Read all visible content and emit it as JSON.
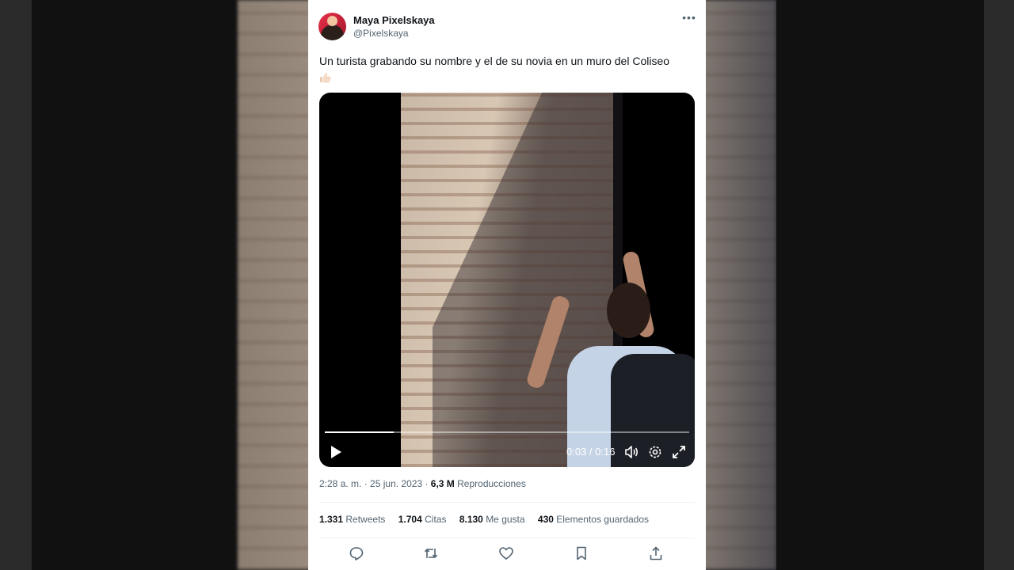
{
  "tweet": {
    "display_name": "Maya Pixelskaya",
    "handle": "@Pixelskaya",
    "text": "Un turista grabando su nombre y el de su novia en un muro del Coliseo",
    "emoji": "thumbs-up-icon"
  },
  "video": {
    "time_display": "0:03 / 0:16",
    "progress_fraction": 0.19,
    "controls": [
      "play-icon",
      "volume-icon",
      "gear-icon",
      "fullscreen-icon"
    ]
  },
  "meta": {
    "time": "2:28 a. m.",
    "separator": " · ",
    "date": "25 jun. 2023",
    "views_count": "6,3 M",
    "views_label": "Reproducciones"
  },
  "stats": {
    "retweets_count": "1.331",
    "retweets_label": "Retweets",
    "quotes_count": "1.704",
    "quotes_label": "Citas",
    "likes_count": "8.130",
    "likes_label": "Me gusta",
    "bookmarks_count": "430",
    "bookmarks_label": "Elementos guardados"
  },
  "actions": [
    "reply-icon",
    "retweet-icon",
    "like-icon",
    "bookmark-icon",
    "share-icon"
  ],
  "colors": {
    "text_primary": "#0f1419",
    "text_secondary": "#536471",
    "divider": "#eff3f4",
    "avatar_bg": "#e8304a"
  }
}
